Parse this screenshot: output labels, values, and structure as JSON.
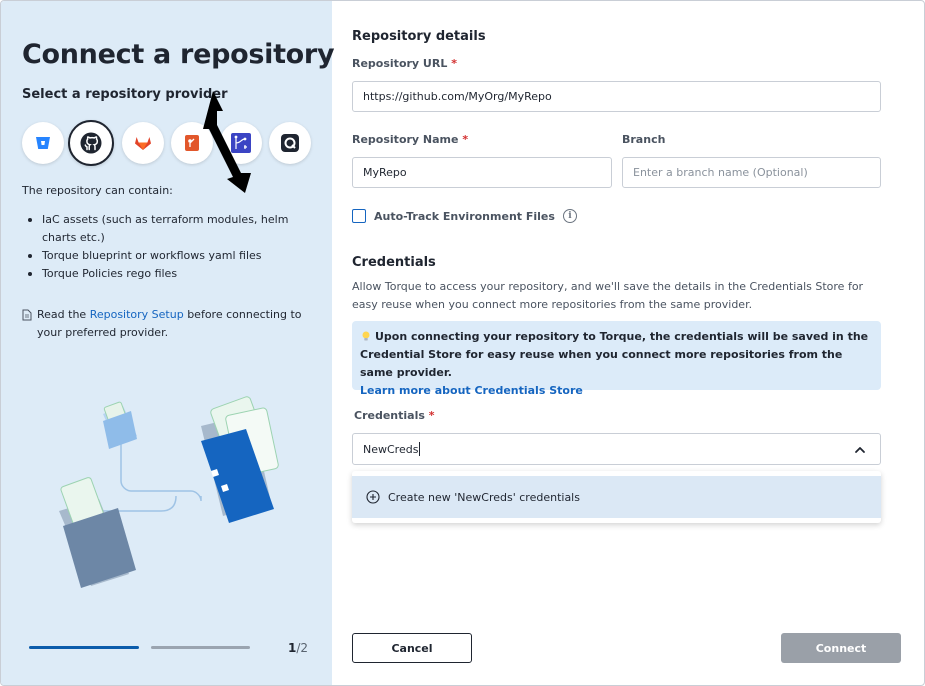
{
  "left": {
    "title": "Connect a repository",
    "subtitle": "Select a repository provider",
    "providers": [
      {
        "name": "bitbucket-icon",
        "color": "#2684ff"
      },
      {
        "name": "github-icon",
        "color": "#1f2530",
        "selected": true
      },
      {
        "name": "gitlab-icon",
        "color": "#e24329"
      },
      {
        "name": "gitea-icon",
        "color": "#e2572b"
      },
      {
        "name": "azure-repos-icon",
        "color": "#3b44c4"
      },
      {
        "name": "quali-icon",
        "color": "#1f2530"
      }
    ],
    "contain_label": "The repository can contain:",
    "bullets": [
      "IaC assets (such as terraform modules, helm charts etc.)",
      "Torque blueprint or workflows yaml files",
      "Torque Policies rego files"
    ],
    "read_prefix": "Read the ",
    "read_link": "Repository Setup",
    "read_suffix": " before connecting to your preferred provider.",
    "page_current": "1",
    "page_total": "/2",
    "progress_step": 1,
    "progress_steps": 2
  },
  "details": {
    "title": "Repository details",
    "url_label": "Repository URL",
    "required_mark": "*",
    "url_value": "https://github.com/MyOrg/MyRepo",
    "name_label": "Repository Name",
    "name_value": "MyRepo",
    "branch_label": "Branch",
    "branch_placeholder": "Enter a branch name (Optional)",
    "autotrack_label": "Auto-Track Environment Files",
    "autotrack_checked": false
  },
  "credentials": {
    "title": "Credentials",
    "description": "Allow Torque to access your repository, and we'll save the details in the Credentials Store for easy reuse when you connect more repositories from the same provider.",
    "notice_text": "Upon connecting your repository to Torque, the credentials will be saved in the Credential Store for easy reuse when you connect more repositories from the same provider.",
    "notice_link": "Learn more about Credentials Store",
    "field_label": "Credentials",
    "field_value": "NewCreds",
    "dropdown_option": "Create new 'NewCreds' credentials"
  },
  "footer": {
    "cancel_label": "Cancel",
    "connect_label": "Connect"
  },
  "colors": {
    "left_bg": "#ddebf7",
    "accent": "#1565c0",
    "required": "#d32f2f",
    "connect_disabled": "#9aa0a8"
  }
}
